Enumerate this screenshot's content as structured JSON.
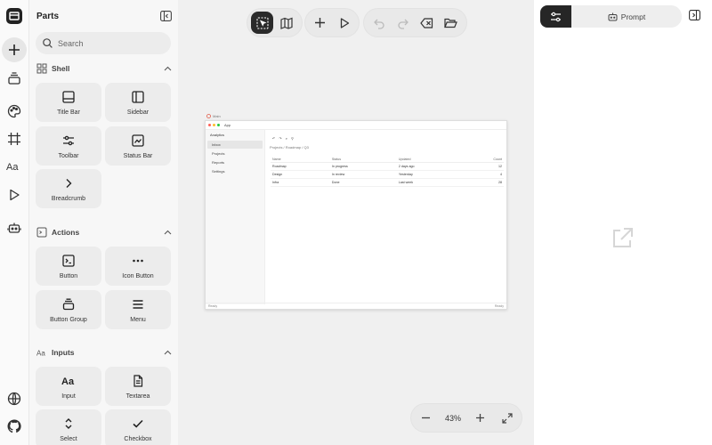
{
  "parts": {
    "title": "Parts",
    "search_placeholder": "Search",
    "sections": [
      {
        "label": "Shell",
        "items": [
          "Title Bar",
          "Sidebar",
          "Toolbar",
          "Status Bar",
          "Breadcrumb"
        ]
      },
      {
        "label": "Actions",
        "items": [
          "Button",
          "Icon Button",
          "Button Group",
          "Menu"
        ]
      },
      {
        "label": "Inputs",
        "items": [
          "Input",
          "Textarea",
          "Select",
          "Checkbox"
        ]
      }
    ]
  },
  "preview": {
    "frame_label": "Main",
    "window_title": "App",
    "brand": "Analytics",
    "nav": [
      "Inbox",
      "Projects",
      "Reports",
      "Settings"
    ],
    "breadcrumb": "Projects  /  Roadmap  /  Q3",
    "table": {
      "headers": [
        "Name",
        "Status",
        "Updated",
        "Count"
      ],
      "rows": [
        [
          "Roadmap",
          "In progress",
          "2 days ago",
          "12"
        ],
        [
          "Design",
          "In review",
          "Yesterday",
          "4"
        ],
        [
          "Infra",
          "Done",
          "Last week",
          "28"
        ]
      ]
    },
    "status_left": "Ready",
    "status_right": "Ready"
  },
  "zoom": {
    "value": "43%"
  },
  "right_panel": {
    "prompt_label": "Prompt"
  },
  "colors": {
    "accent_dark": "#262626",
    "canvas_bg": "#f0f0f0",
    "dot_red": "#ff5f57",
    "dot_yellow": "#febc2e",
    "dot_green": "#28c840"
  }
}
